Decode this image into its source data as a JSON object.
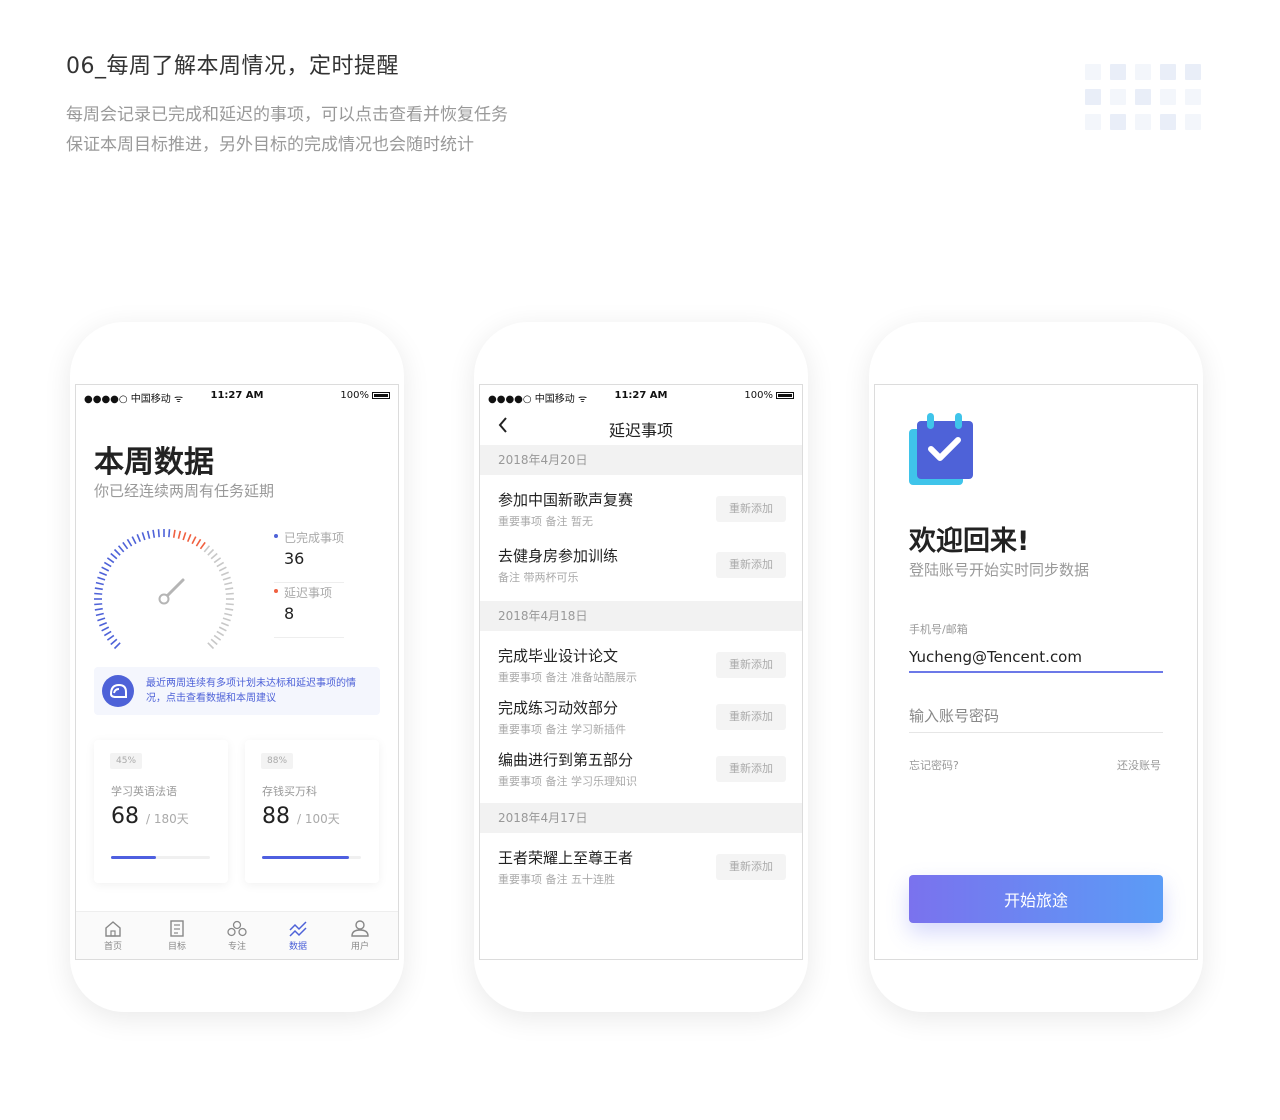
{
  "header": {
    "title": "06_每周了解本周情况，定时提醒",
    "desc_line1": "每周会记录已完成和延迟的事项，可以点击查看并恢复任务",
    "desc_line2": "保证本周目标推进，另外目标的完成情况也会随时统计"
  },
  "status_bar": {
    "carrier": "●●●●○ 中国移动 ᯤ",
    "time": "11:27 AM",
    "battery": "100%"
  },
  "colors": {
    "accent": "#4e62d8",
    "delayed": "#f06040",
    "gradient_start": "#7a72ee",
    "gradient_end": "#5b9cf6"
  },
  "screen1": {
    "title": "本周数据",
    "subtitle": "你已经连续两周有任务延期",
    "legend": [
      {
        "label": "已完成事项",
        "value": "36",
        "color": "#4e62d8"
      },
      {
        "label": "延迟事项",
        "value": "8",
        "color": "#f06040"
      }
    ],
    "tip_text": "最近两周连续有多项计划未达标和延迟事项的情况，点击查看数据和本周建议",
    "cards": [
      {
        "percent": "45%",
        "name": "学习英语法语",
        "value": "68",
        "total": "/ 180天",
        "progress": 0.45
      },
      {
        "percent": "88%",
        "name": "存钱买万科",
        "value": "88",
        "total": "/ 100天",
        "progress": 0.88
      }
    ],
    "tabs": [
      {
        "label": "首页",
        "icon": "home-icon"
      },
      {
        "label": "目标",
        "icon": "target-doc-icon"
      },
      {
        "label": "专注",
        "icon": "focus-icon"
      },
      {
        "label": "数据",
        "icon": "chart-icon"
      },
      {
        "label": "用户",
        "icon": "user-icon"
      }
    ]
  },
  "screen2": {
    "nav_title": "延迟事项",
    "readd_label": "重新添加",
    "groups": [
      {
        "date": "2018年4月20日",
        "items": [
          {
            "title": "参加中国新歌声复赛",
            "meta": "重要事项  备注 暂无"
          },
          {
            "title": "去健身房参加训练",
            "meta": "备注  带两杯可乐"
          }
        ]
      },
      {
        "date": "2018年4月18日",
        "items": [
          {
            "title": "完成毕业设计论文",
            "meta": "重要事项  备注 准备站酷展示"
          },
          {
            "title": "完成练习动效部分",
            "meta": "重要事项  备注 学习新插件"
          },
          {
            "title": "编曲进行到第五部分",
            "meta": "重要事项  备注 学习乐理知识"
          }
        ]
      },
      {
        "date": "2018年4月17日",
        "items": [
          {
            "title": "王者荣耀上至尊王者",
            "meta": "重要事项  备注 五十连胜"
          }
        ]
      }
    ]
  },
  "screen3": {
    "title": "欢迎回来!",
    "subtitle": "登陆账号开始实时同步数据",
    "account_label": "手机号/邮箱",
    "account_value": "Yucheng@Tencent.com",
    "password_placeholder": "输入账号密码",
    "forgot": "忘记密码?",
    "no_account": "还没账号",
    "start_button": "开始旅途"
  }
}
